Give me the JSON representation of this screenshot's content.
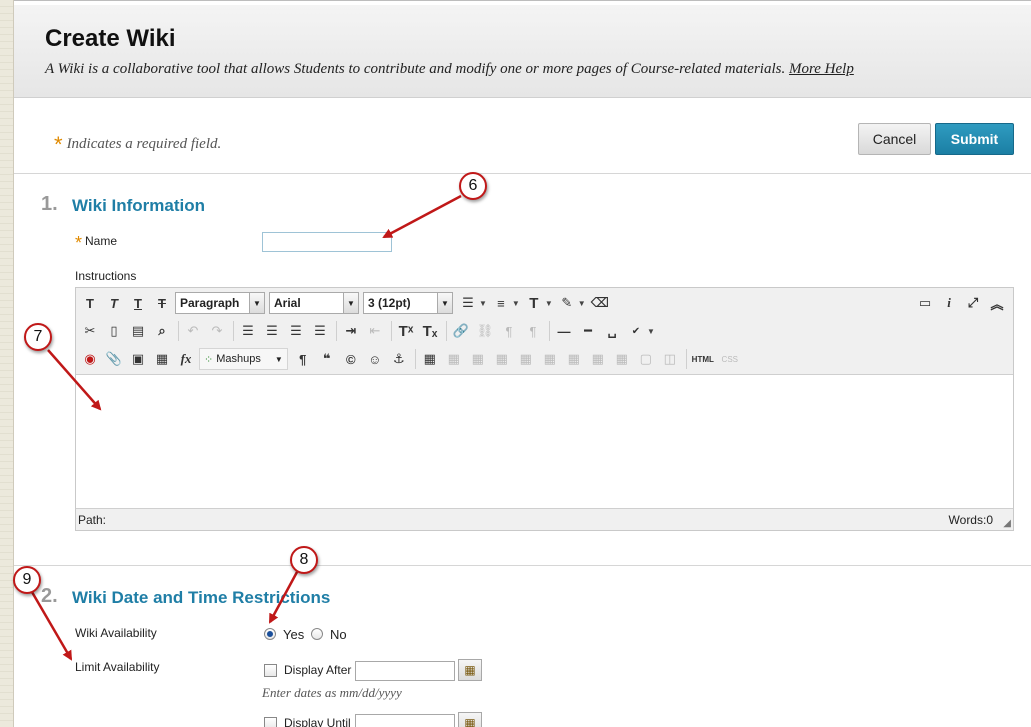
{
  "header": {
    "title": "Create Wiki",
    "description": "A Wiki is a collaborative tool that allows Students to contribute and modify one or more pages of Course-related materials.",
    "help_link": "More Help"
  },
  "required_note": {
    "star": "*",
    "text": "Indicates a required field."
  },
  "actions": {
    "cancel": "Cancel",
    "submit": "Submit"
  },
  "section1": {
    "number": "1.",
    "title": "Wiki Information",
    "name_label": "Name",
    "name_value": "",
    "instructions_label": "Instructions"
  },
  "editor": {
    "format_select": "Paragraph",
    "font_select": "Arial",
    "size_select": "3 (12pt)",
    "mashups_label": "Mashups",
    "html_label": "HTML",
    "css_label": "CSS",
    "path_label": "Path:",
    "words_label": "Words:0"
  },
  "section2": {
    "number": "2.",
    "title": "Wiki Date and Time Restrictions",
    "availability_label": "Wiki Availability",
    "yes_label": "Yes",
    "no_label": "No",
    "availability_selected": "Yes",
    "limit_label": "Limit Availability",
    "display_after_label": "Display After",
    "display_after_value": "",
    "date_hint": "Enter dates as mm/dd/yyyy",
    "display_until_label": "Display Until",
    "display_until_value": ""
  },
  "callouts": {
    "c6": "6",
    "c7": "7",
    "c8": "8",
    "c9": "9"
  },
  "colors": {
    "accent": "#1f7ea6",
    "submit": "#1b7fa4",
    "required": "#e08a00",
    "callout_arrow": "#c01818"
  }
}
